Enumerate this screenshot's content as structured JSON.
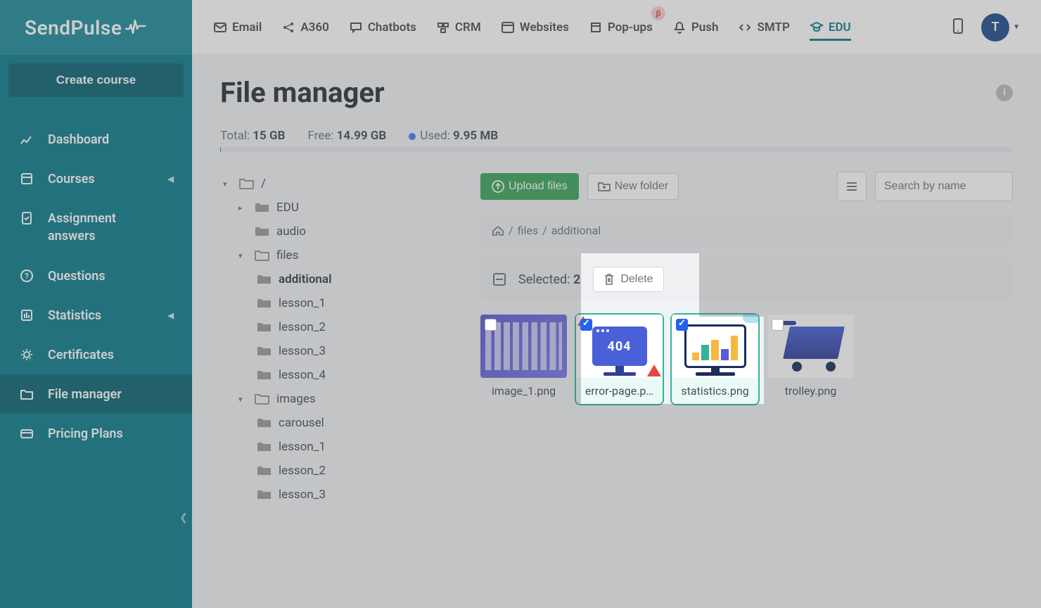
{
  "brand": "SendPulse",
  "sidebar": {
    "cta": "Create course",
    "items": [
      {
        "label": "Dashboard"
      },
      {
        "label": "Courses",
        "chev": true
      },
      {
        "label": "Assignment answers"
      },
      {
        "label": "Questions"
      },
      {
        "label": "Statistics",
        "chev": true
      },
      {
        "label": "Certificates"
      },
      {
        "label": "File manager",
        "active": true
      },
      {
        "label": "Pricing Plans"
      }
    ]
  },
  "topnav": {
    "items": [
      {
        "label": "Email"
      },
      {
        "label": "A360"
      },
      {
        "label": "Chatbots"
      },
      {
        "label": "CRM"
      },
      {
        "label": "Websites"
      },
      {
        "label": "Pop-ups",
        "beta": "β"
      },
      {
        "label": "Push"
      },
      {
        "label": "SMTP"
      },
      {
        "label": "EDU",
        "active": true
      }
    ],
    "avatar_initial": "T"
  },
  "page": {
    "title": "File manager",
    "storage": {
      "total_label": "Total:",
      "total": "15 GB",
      "free_label": "Free:",
      "free": "14.99 GB",
      "used_label": "Used:",
      "used": "9.95 MB"
    }
  },
  "tree": [
    {
      "label": "/",
      "level": 0,
      "open": true
    },
    {
      "label": "EDU",
      "level": 1,
      "toggle": "›"
    },
    {
      "label": "audio",
      "level": 1
    },
    {
      "label": "files",
      "level": 1,
      "open": true
    },
    {
      "label": "additional",
      "level": 2,
      "bold": true
    },
    {
      "label": "lesson_1",
      "level": 2
    },
    {
      "label": "lesson_2",
      "level": 2
    },
    {
      "label": "lesson_3",
      "level": 2
    },
    {
      "label": "lesson_4",
      "level": 2
    },
    {
      "label": "images",
      "level": 1,
      "open": true
    },
    {
      "label": "carousel",
      "level": 2
    },
    {
      "label": "lesson_1",
      "level": 2
    },
    {
      "label": "lesson_2",
      "level": 2
    },
    {
      "label": "lesson_3",
      "level": 2
    }
  ],
  "toolbar": {
    "upload": "Upload files",
    "newfolder": "New folder",
    "search_placeholder": "Search by name"
  },
  "breadcrumb": {
    "sep": "/",
    "parts": [
      "files",
      "additional"
    ]
  },
  "selection": {
    "label_prefix": "Selected:",
    "count": "2",
    "delete": "Delete"
  },
  "files": [
    {
      "name": "image_1.png",
      "selected": false,
      "thumb": "t1"
    },
    {
      "name": "error-page.p…",
      "selected": true,
      "thumb": "t2"
    },
    {
      "name": "statistics.png",
      "selected": true,
      "thumb": "t3"
    },
    {
      "name": "trolley.png",
      "selected": false,
      "thumb": "t4"
    }
  ]
}
